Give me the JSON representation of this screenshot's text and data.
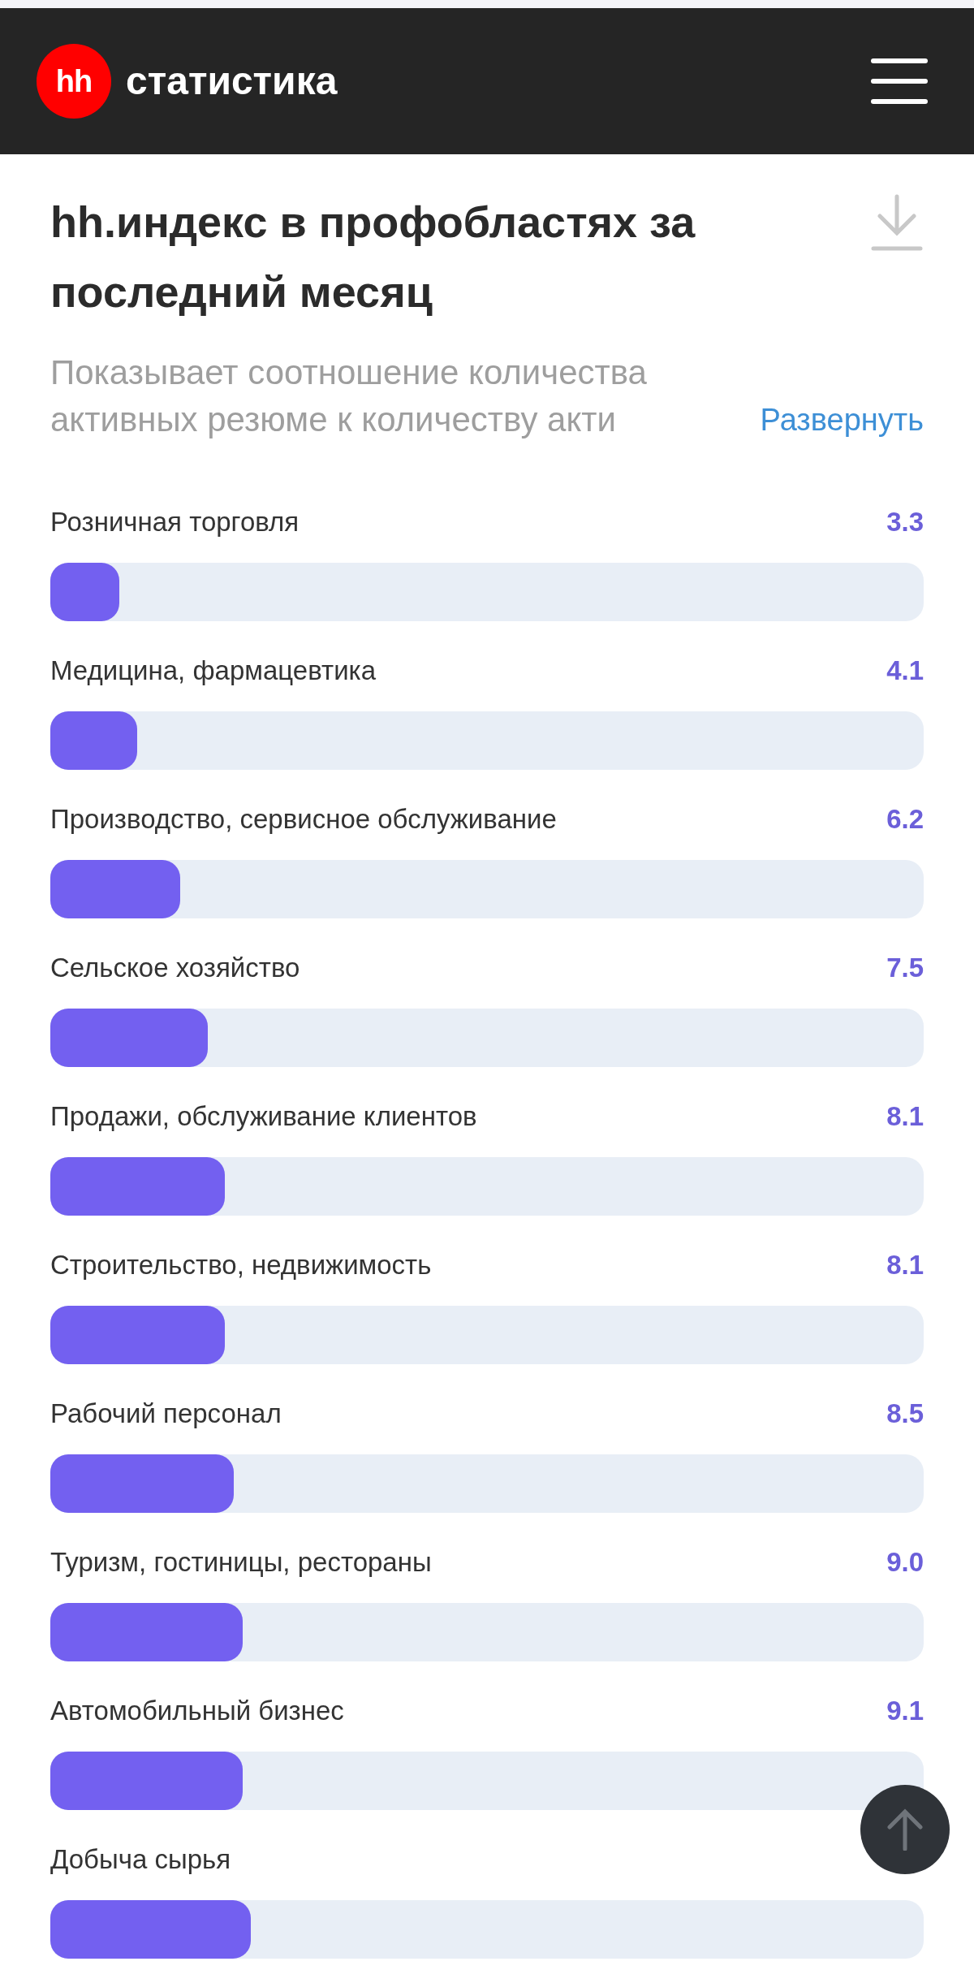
{
  "header": {
    "logo": "hh",
    "title": "статистика"
  },
  "title": "hh.индекс в профобластях за последний месяц",
  "description": "Показывает соотношение количества активных резюме к количеству акти",
  "expand_link": "Развернуть",
  "rows": [
    {
      "label": "Розничная торговля",
      "value": "3.3",
      "level": 0.079
    },
    {
      "label": "Медицина, фармацевтика",
      "value": "4.1",
      "level": 0.099
    },
    {
      "label": "Производство, сервисное обслуживание",
      "value": "6.2",
      "level": 0.149
    },
    {
      "label": "Сельское хозяйство",
      "value": "7.5",
      "level": 0.18
    },
    {
      "label": "Продажи, обслуживание клиентов",
      "value": "8.1",
      "level": 0.2
    },
    {
      "label": "Строительство, недвижимость",
      "value": "8.1",
      "level": 0.2
    },
    {
      "label": "Рабочий персонал",
      "value": "8.5",
      "level": 0.21
    },
    {
      "label": "Туризм, гостиницы, рестораны",
      "value": "9.0",
      "level": 0.22
    },
    {
      "label": "Автомобильный бизнес",
      "value": "9.1",
      "level": 0.22
    },
    {
      "label": "Добыча сырья",
      "level": 0.23
    }
  ]
}
